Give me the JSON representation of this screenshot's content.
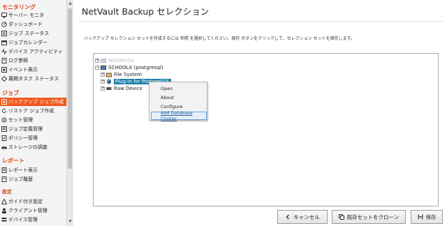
{
  "sidebar": {
    "sections": [
      {
        "title": "モニタリング",
        "items": [
          {
            "label": "サーバー モニタ",
            "icon": "monitor-icon"
          },
          {
            "label": "ダッシュボード",
            "icon": "dashboard-icon"
          },
          {
            "label": "ジョブ ステータス",
            "icon": "job-status-icon"
          },
          {
            "label": "ジョブカレンダー",
            "icon": "calendar-icon"
          },
          {
            "label": "デバイス アクティビティ",
            "icon": "activity-icon"
          },
          {
            "label": "ログ参照",
            "icon": "log-icon"
          },
          {
            "label": "イベント表示",
            "icon": "event-icon"
          },
          {
            "label": "展開タスク ステータス",
            "icon": "deploy-icon"
          }
        ]
      },
      {
        "title": "ジョブ",
        "items": [
          {
            "label": "バックアップ ジョブ作成",
            "icon": "backup-icon",
            "active": true
          },
          {
            "label": "リストア ジョブ作成",
            "icon": "restore-icon"
          },
          {
            "label": "セット管理",
            "icon": "sets-icon"
          },
          {
            "label": "ジョブ定義管理",
            "icon": "job-definition-icon"
          },
          {
            "label": "ポリシー管理",
            "icon": "policy-icon"
          },
          {
            "label": "ストレージの調査",
            "icon": "binoculars-icon"
          }
        ]
      },
      {
        "title": "レポート",
        "items": [
          {
            "label": "レポート表示",
            "icon": "report-icon"
          },
          {
            "label": "ジョブ履歴",
            "icon": "history-icon"
          }
        ]
      },
      {
        "title": "設定",
        "items": [
          {
            "label": "ガイド付き設定",
            "icon": "guide-icon"
          },
          {
            "label": "クライアント管理",
            "icon": "client-icon"
          },
          {
            "label": "デバイス管理",
            "icon": "device-icon"
          }
        ]
      }
    ]
  },
  "main": {
    "title": "NetVault Backup セレクション",
    "description": "バックアップ セレクション セットを作成するには 参照 を選択してください。保存 ボタンをクリックして、セレクション セットを保存します。"
  },
  "tree": {
    "nodes": [
      {
        "label": "WS2N\\VSV",
        "faint": true,
        "level": 0,
        "expand": "+",
        "icon": "server-icon"
      },
      {
        "label": "SCHOOLX    (postgresql)",
        "level": 0,
        "expand": "−",
        "icon": "server-icon"
      },
      {
        "label": "File System",
        "level": 1,
        "expand": "+",
        "icon": "filesystem-icon"
      },
      {
        "label": "Plug-in for PostgreSQL",
        "level": 1,
        "expand": "+",
        "icon": "postgresql-icon",
        "selected": true
      },
      {
        "label": "Raw Device",
        "level": 1,
        "expand": "+",
        "icon": "raw-device-icon"
      }
    ]
  },
  "context_menu": {
    "items": [
      "Open",
      "About",
      "Configure",
      "Add Database Cluster"
    ]
  },
  "buttons": {
    "cancel": "キャンセル",
    "clone": "既存セットをクローン",
    "save": "保存"
  },
  "colors": {
    "accent": "#f05a1c",
    "section_title": "#d9461c",
    "selected_node": "#1e7fa8"
  }
}
